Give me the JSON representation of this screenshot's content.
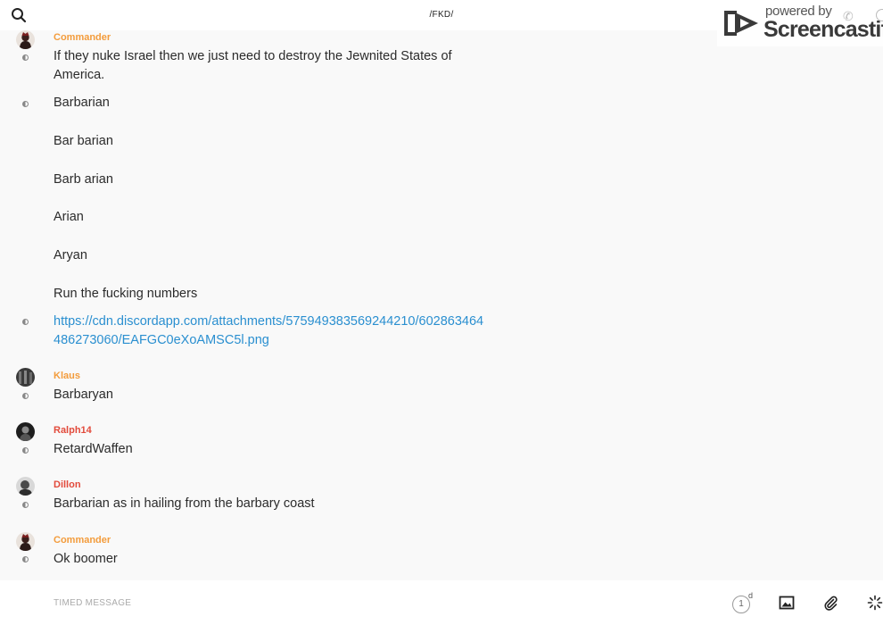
{
  "header": {
    "channel": "/FKD/"
  },
  "watermark": {
    "powered": "powered by",
    "brand": "Screencastify"
  },
  "messages": [
    {
      "author": "Commander",
      "text": "If they nuke Israel then we just need to destroy the Jewnited States of America."
    },
    {
      "text": "Barbarian"
    },
    {
      "text": "Bar barian"
    },
    {
      "text": "Barb arian"
    },
    {
      "text": "Arian"
    },
    {
      "text": "Aryan"
    },
    {
      "text": "Run the fucking numbers"
    },
    {
      "text": "https://cdn.discordapp.com/attachments/575949383569244210/602863464486273060/EAFGC0eXoAMSC5l.png"
    },
    {
      "author": "Klaus",
      "text": "Barbaryan"
    },
    {
      "author": "Ralph14",
      "text": "RetardWaffen"
    },
    {
      "author": "Dillon",
      "text": "Barbarian as in hailing from the barbary coast"
    },
    {
      "author": "Commander",
      "text": "Ok boomer"
    }
  ],
  "composer": {
    "placeholder": "TIMED MESSAGE",
    "timer_value": "1",
    "timer_unit": "d"
  },
  "colors": {
    "author_orange": "#f39c3c",
    "author_red": "#e24b3c",
    "link": "#2a8fd0"
  }
}
